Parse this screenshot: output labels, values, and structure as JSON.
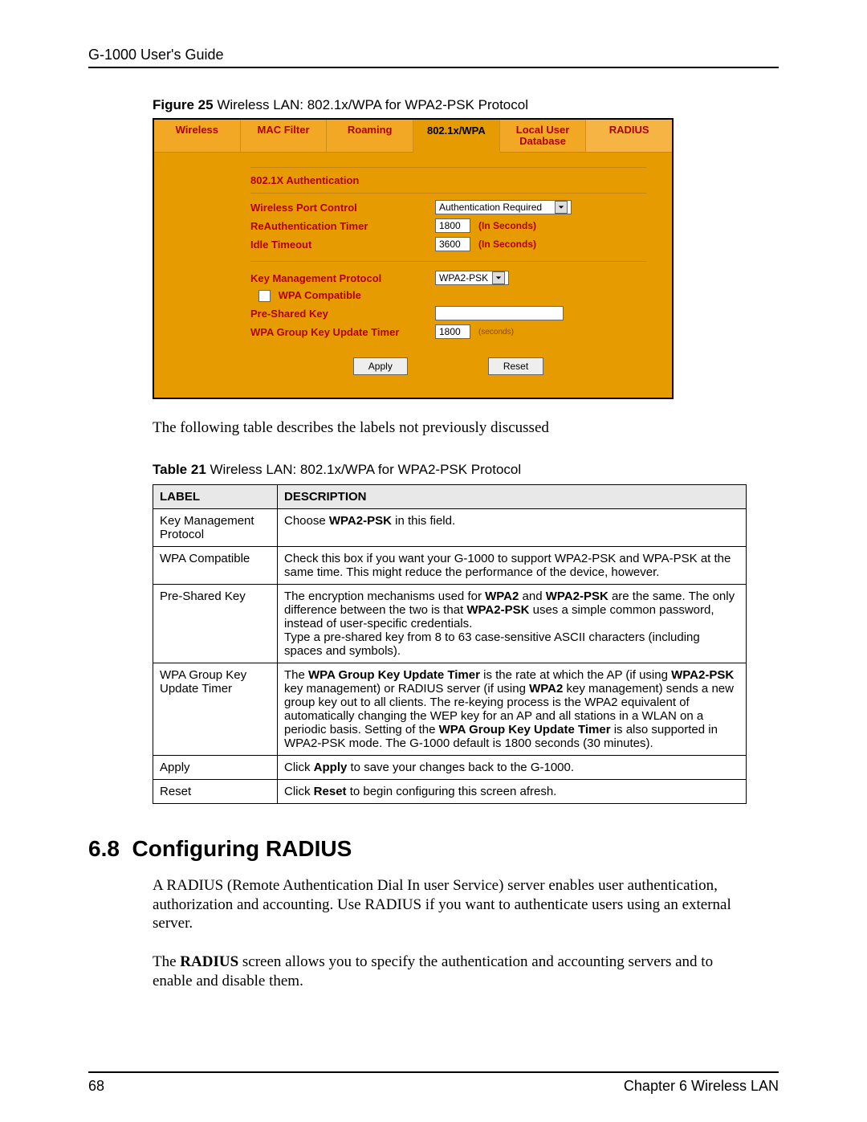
{
  "header": "G-1000 User's Guide",
  "figure": {
    "lead": "Figure 25",
    "rest": "   Wireless LAN: 802.1x/WPA for WPA2-PSK Protocol",
    "tabs": [
      "Wireless",
      "MAC Filter",
      "Roaming",
      "802.1x/WPA",
      "Local User Database",
      "RADIUS"
    ],
    "active_tab": "802.1x/WPA",
    "sec1_title": "802.1X Authentication",
    "wpc_label": "Wireless Port Control",
    "wpc_value": "Authentication Required",
    "reauth_label": "ReAuthentication Timer",
    "reauth_value": "1800",
    "idle_label": "Idle Timeout",
    "idle_value": "3600",
    "in_seconds": "(In Seconds)",
    "kmp_label": "Key Management Protocol",
    "kmp_value": "WPA2-PSK",
    "wpa_compat_label": "WPA Compatible",
    "psk_label": "Pre-Shared Key",
    "pskt_label": "WPA Group Key Update Timer",
    "pskt_value": "1800",
    "seconds": "(seconds)",
    "apply": "Apply",
    "reset": "Reset"
  },
  "para1": "The following table describes the labels not previously discussed",
  "table": {
    "lead": "Table 21",
    "rest": "   Wireless LAN: 802.1x/WPA for WPA2-PSK Protocol",
    "h1": "LABEL",
    "h2": "DESCRIPTION",
    "rows": [
      {
        "label": "Key Management Protocol",
        "desc": "Choose <b>WPA2-PSK</b> in this field."
      },
      {
        "label": "WPA Compatible",
        "desc": "Check this box if you want your G-1000 to support WPA2-PSK and WPA-PSK at the same time. This might reduce the performance of the device, however."
      },
      {
        "label": "Pre-Shared Key",
        "desc": "The encryption mechanisms used for <b>WPA2</b> and <b>WPA2-PSK</b> are the same. The only difference between the two is that <b>WPA2-PSK</b> uses a simple common password, instead of user-specific credentials.<br>Type a pre-shared key from 8 to 63 case-sensitive ASCII characters (including spaces and symbols)."
      },
      {
        "label": "WPA Group Key Update Timer",
        "desc": "The <b>WPA Group Key Update Timer</b> is the rate at which the AP (if using <b>WPA2-PSK</b> key management) or RADIUS server (if using <b>WPA2</b> key management) sends a new group key out to all clients. The re-keying process is the WPA2 equivalent of automatically changing the WEP key for an AP and all stations in a WLAN on a periodic basis. Setting of the <b>WPA Group Key Update Timer</b> is also supported in WPA2-PSK mode. The G-1000 default is 1800 seconds (30 minutes)."
      },
      {
        "label": "Apply",
        "desc": "Click <b>Apply</b> to save your changes back to the G-1000."
      },
      {
        "label": "Reset",
        "desc": "Click <b>Reset</b> to begin configuring this screen afresh."
      }
    ]
  },
  "section": {
    "num": "6.8",
    "title": "Configuring RADIUS"
  },
  "para2": "A RADIUS (Remote Authentication Dial In user Service) server enables user authentication, authorization and accounting. Use RADIUS if you want to authenticate users using an external server.",
  "para3_pre": "The ",
  "para3_b": "RADIUS",
  "para3_post": " screen allows you to specify the authentication and accounting servers and to enable and disable them.",
  "footer": {
    "page": "68",
    "chapter": "Chapter 6 Wireless LAN"
  }
}
